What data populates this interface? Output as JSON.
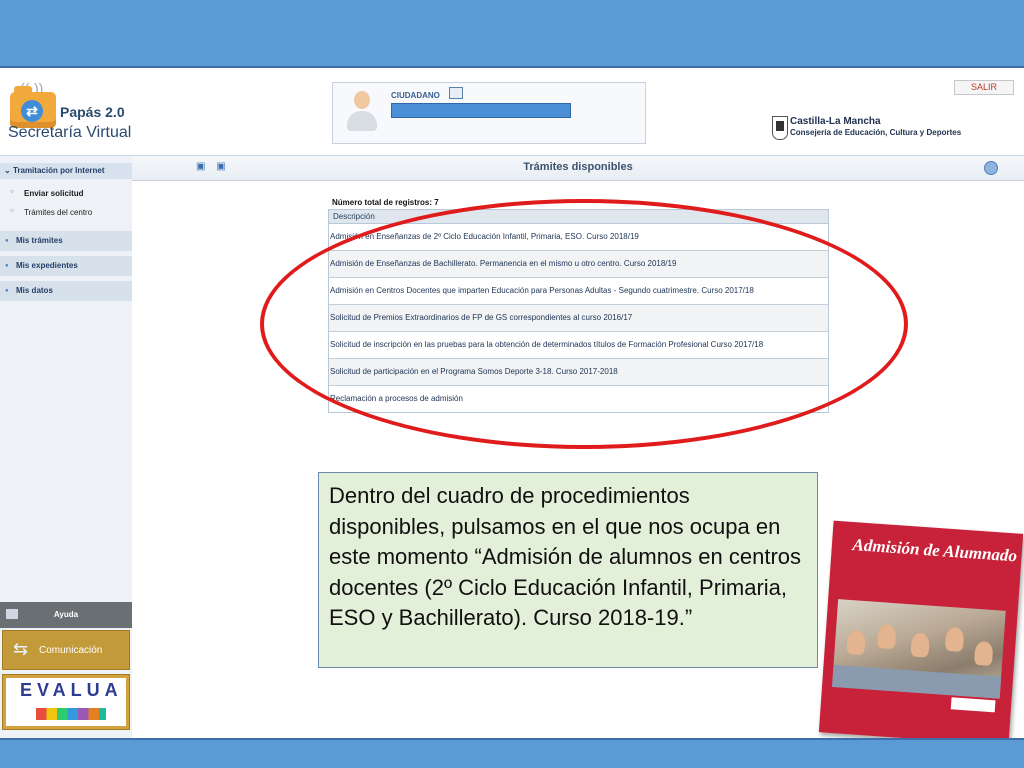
{
  "header": {
    "logo_title": "Papás 2.0",
    "logo_subtitle": "Secretaría Virtual",
    "citizen_label": "CIUDADANO",
    "exit_button": "SALIR",
    "jccm_name": "Castilla-La Mancha",
    "jccm_dept": "Consejería de Educación, Cultura y Deportes"
  },
  "sidebar": {
    "section": "Tramitación por Internet",
    "subitems": [
      "Enviar solicitud",
      "Trámites del centro"
    ],
    "items": [
      "Mis trámites",
      "Mis expedientes",
      "Mis datos"
    ],
    "help": "Ayuda",
    "communication": "Comunicación",
    "evalua": "EVALUA"
  },
  "content": {
    "title": "Trámites disponibles",
    "total": "Número total de registros: 7",
    "column": "Descripción",
    "rows": [
      "Admisión en Enseñanzas de 2º Ciclo Educación Infantil, Primaria, ESO. Curso 2018/19",
      "Admisión de Enseñanzas de Bachillerato. Permanencia en el mismo u otro centro. Curso 2018/19",
      "Admisión en Centros Docentes que imparten Educación para Personas Adultas - Segundo cuatrimestre. Curso 2017/18",
      "Solicitud de Premios Extraordinarios de FP de GS correspondientes al curso 2016/17",
      "Solicitud de inscripción en las pruebas para la obtención de determinados títulos de Formación Profesional Curso 2017/18",
      "Solicitud de participación en el Programa Somos Deporte 3-18. Curso 2017-2018",
      "Reclamación a procesos de admisión"
    ]
  },
  "note": {
    "text": "Dentro del cuadro de procedimientos disponibles, pulsamos en el que nos ocupa en este momento “Admisión de alumnos en centros docentes (2º Ciclo Educación Infantil, Primaria, ESO y Bachillerato). Curso 2018-19.”"
  },
  "brochure": {
    "title": "Admisión de Alumnado"
  },
  "colors": {
    "bar_blue": "#5b9bd5",
    "highlight_red": "#e01b1b",
    "note_green": "#e2efd9",
    "brochure_red": "#c8223a"
  }
}
